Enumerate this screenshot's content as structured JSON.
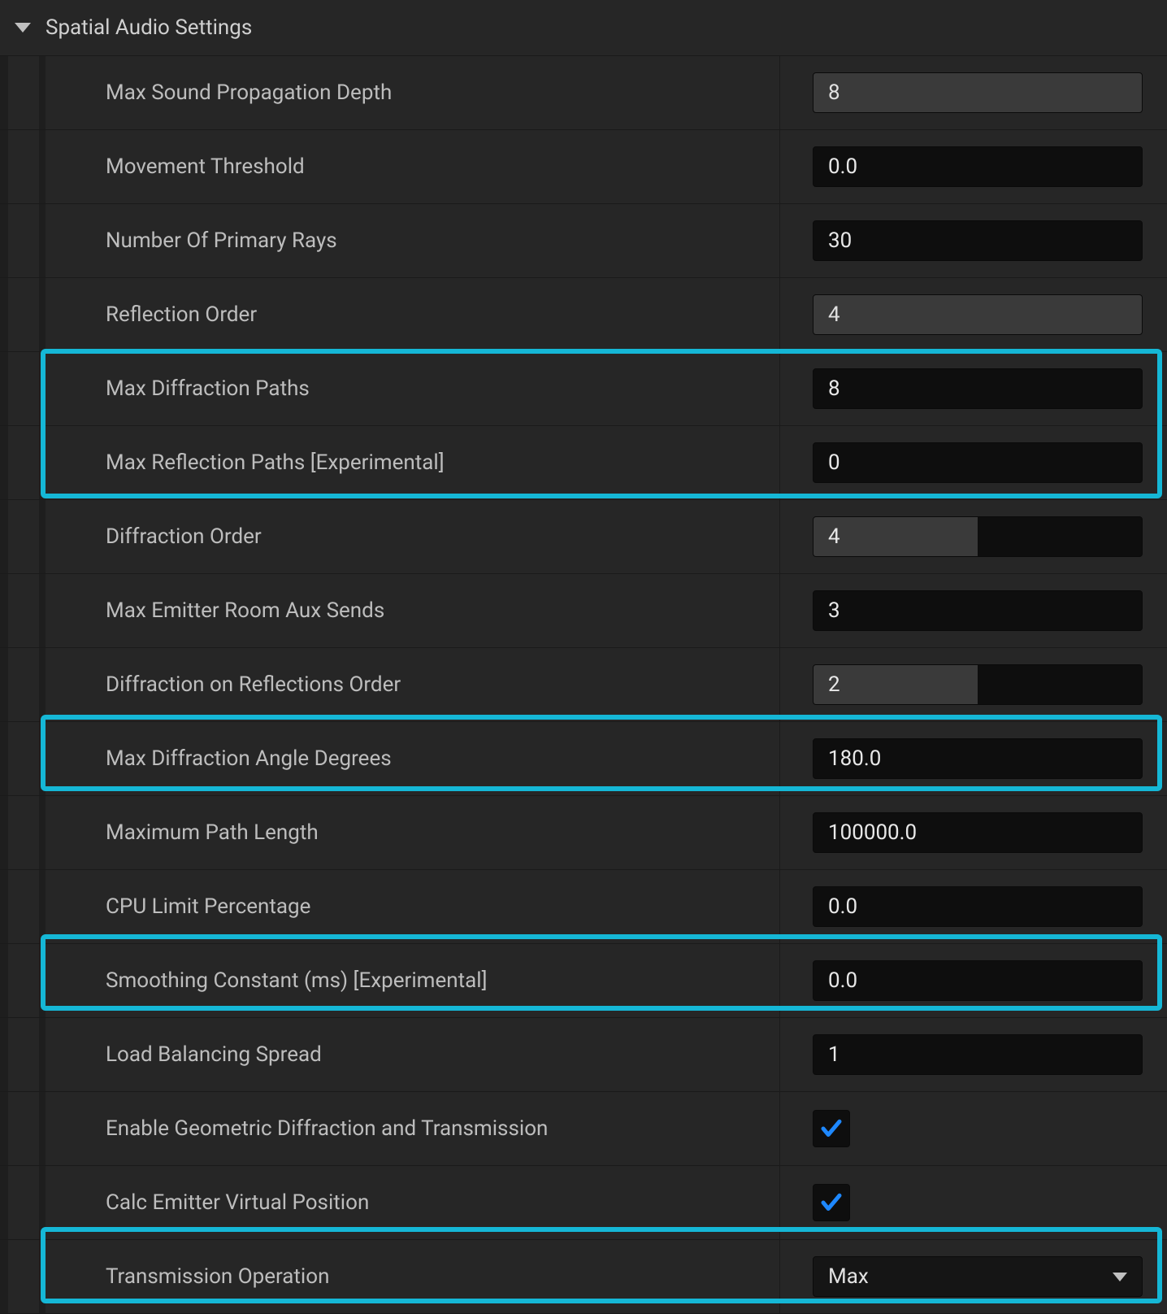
{
  "section": {
    "title": "Spatial Audio Settings"
  },
  "rows": {
    "maxSoundPropDepth": {
      "label": "Max Sound Propagation Depth",
      "value": "8"
    },
    "movementThreshold": {
      "label": "Movement Threshold",
      "value": "0.0"
    },
    "numPrimaryRays": {
      "label": "Number Of Primary Rays",
      "value": "30"
    },
    "reflectionOrder": {
      "label": "Reflection Order",
      "value": "4"
    },
    "maxDiffractionPaths": {
      "label": "Max Diffraction Paths",
      "value": "8"
    },
    "maxReflectionPaths": {
      "label": "Max Reflection Paths [Experimental]",
      "value": "0"
    },
    "diffractionOrder": {
      "label": "Diffraction Order",
      "value": "4"
    },
    "maxEmitterRoomAuxSends": {
      "label": "Max Emitter Room Aux Sends",
      "value": "3"
    },
    "diffractionOnReflectionsOrder": {
      "label": "Diffraction on Reflections Order",
      "value": "2"
    },
    "maxDiffractionAngleDegrees": {
      "label": "Max Diffraction Angle Degrees",
      "value": "180.0"
    },
    "maximumPathLength": {
      "label": "Maximum Path Length",
      "value": "100000.0"
    },
    "cpuLimitPercentage": {
      "label": "CPU Limit Percentage",
      "value": "0.0"
    },
    "smoothingConstant": {
      "label": "Smoothing Constant (ms) [Experimental]",
      "value": "0.0"
    },
    "loadBalancingSpread": {
      "label": "Load Balancing Spread",
      "value": "1"
    },
    "enableGeomDiffTrans": {
      "label": "Enable Geometric Diffraction and Transmission",
      "checked": true
    },
    "calcEmitterVirtualPos": {
      "label": "Calc Emitter Virtual Position",
      "checked": true
    },
    "transmissionOperation": {
      "label": "Transmission Operation",
      "value": "Max"
    }
  },
  "highlight_color": "#15b7d6",
  "check_color": "#1e88ff"
}
